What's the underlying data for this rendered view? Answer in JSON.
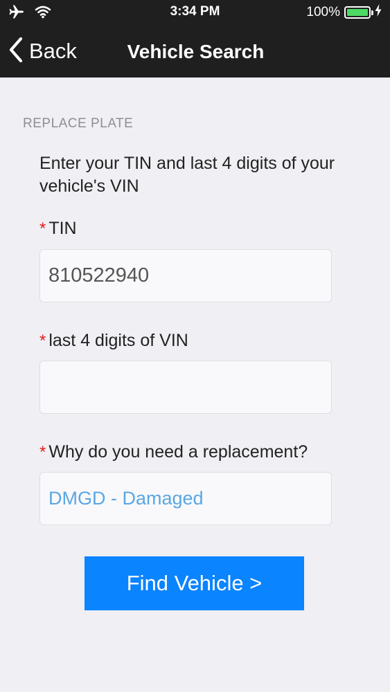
{
  "status_bar": {
    "time": "3:34 PM",
    "battery_percent": "100%",
    "battery_level": 1.0,
    "icons": [
      "airplane-icon",
      "wifi-icon",
      "battery-icon",
      "charging-bolt-icon"
    ]
  },
  "nav": {
    "back_label": "Back",
    "title": "Vehicle Search"
  },
  "form": {
    "section_label": "REPLACE PLATE",
    "instructions": "Enter your TIN and last 4 digits of your vehicle's VIN",
    "required_marker": "*",
    "tin_label": "TIN",
    "tin_value": "810522940",
    "vin_label": "last 4 digits of VIN",
    "vin_value": "",
    "reason_label": "Why do you need a replacement?",
    "reason_value": "DMGD - Damaged",
    "submit_label": "Find Vehicle  >"
  },
  "colors": {
    "header_bg": "#1f1f1f",
    "page_bg": "#efeff4",
    "accent_button": "#0a84ff",
    "select_text": "#5aa6e4",
    "required": "#e02020",
    "battery": "#4cd964"
  }
}
